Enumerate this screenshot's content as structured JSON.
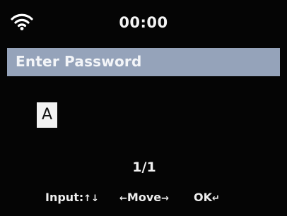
{
  "status_bar": {
    "wifi_icon": "wifi-icon",
    "time": "00:00"
  },
  "header": {
    "title": "Enter Password",
    "background_color": "#95a3ba"
  },
  "password_entry": {
    "current_char": "A"
  },
  "page_indicator": "1/1",
  "hints": {
    "input": "Input:",
    "input_arrows": "↑↓",
    "move_left_arrow": "←",
    "move": "Move",
    "move_right_arrow": "→",
    "ok": "OK",
    "ok_arrow": "↵"
  }
}
